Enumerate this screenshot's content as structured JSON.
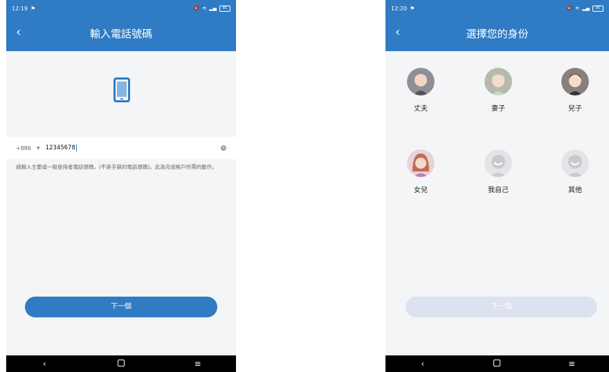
{
  "left": {
    "status": {
      "time": "12:19",
      "flag": "⚑"
    },
    "title": "輸入電話號碼",
    "back": "‹",
    "country_code": "+886",
    "caret": "▼",
    "phone_value": "12345678",
    "clear": "×",
    "hint": "請輸入主要或一般使用者電話號碼，(不是手錶的電話號碼)。此為完成帳戶所需的動作。",
    "next_label": "下一個"
  },
  "right": {
    "status": {
      "time": "12:20",
      "flag": "⚑"
    },
    "title": "選擇您的身份",
    "back": "‹",
    "roles": [
      {
        "label": "丈夫",
        "color": "#8f8f95"
      },
      {
        "label": "妻子",
        "color": "#b6b9ad"
      },
      {
        "label": "兒子",
        "color": "#8a7f79"
      },
      {
        "label": "女兒",
        "color": "#c46b57"
      },
      {
        "label": "我自己",
        "color": "#c8cacd"
      },
      {
        "label": "其他",
        "color": "#c8cacd"
      }
    ],
    "next_label": "下一個"
  },
  "status_icons": {
    "mute": "🔇",
    "wifi": "≋",
    "signal": "▂▄",
    "battery": "85"
  },
  "nav": {
    "back": "‹",
    "menu": "≡"
  },
  "colors": {
    "primary": "#2f7bc4",
    "disabled": "#dde2f0"
  }
}
